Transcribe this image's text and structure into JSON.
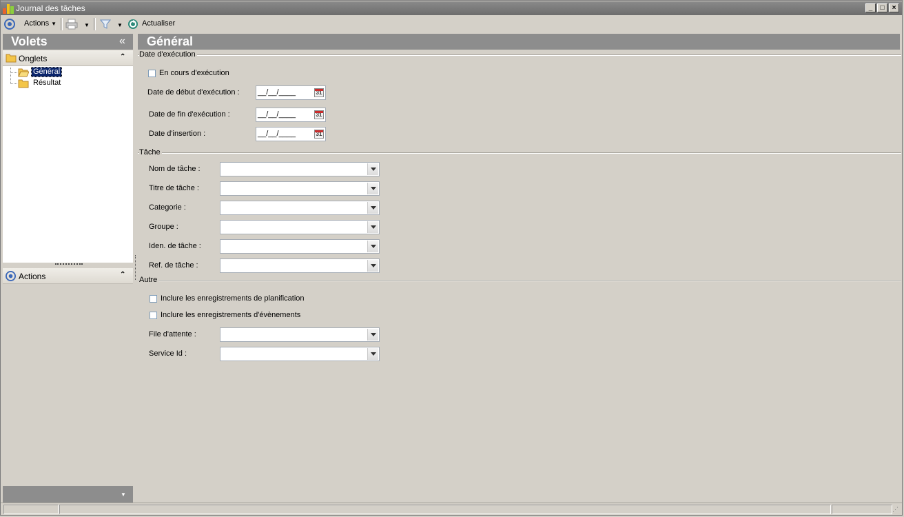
{
  "window": {
    "title": "Journal des tâches"
  },
  "toolbar": {
    "actions_label": "Actions",
    "refresh_label": "Actualiser"
  },
  "sidebar": {
    "title": "Volets",
    "collapse_glyph": "«",
    "tabs_section": {
      "label": "Onglets",
      "items": [
        {
          "label": "Général",
          "selected": true
        },
        {
          "label": "Résultat",
          "selected": false
        }
      ]
    },
    "actions_section": {
      "label": "Actions"
    }
  },
  "main": {
    "title": "Général",
    "execution_group": {
      "title": "Date d'exécution",
      "in_progress_label": "En cours d'exécution",
      "start_date_label": "Date de début d'exécution  :",
      "end_date_label": "Date de fin d'exécution :",
      "insert_date_label": "Date d'insertion :",
      "date_mask": "__/__/____",
      "calendar_day": "31"
    },
    "task_group": {
      "title": "Tâche",
      "fields": [
        {
          "label": "Nom de tâche :",
          "value": ""
        },
        {
          "label": "Titre de tâche :",
          "value": ""
        },
        {
          "label": "Categorie :",
          "value": ""
        },
        {
          "label": "Groupe :",
          "value": ""
        },
        {
          "label": "Iden. de tâche :",
          "value": ""
        },
        {
          "label": "Ref. de tâche :",
          "value": ""
        }
      ]
    },
    "other_group": {
      "title": "Autre",
      "include_planning_label": "Inclure les enregistrements de planification",
      "include_events_label": "Inclure les enregistrements d'évènements",
      "queue_label": "File d'attente :",
      "service_label": "Service Id :"
    }
  }
}
